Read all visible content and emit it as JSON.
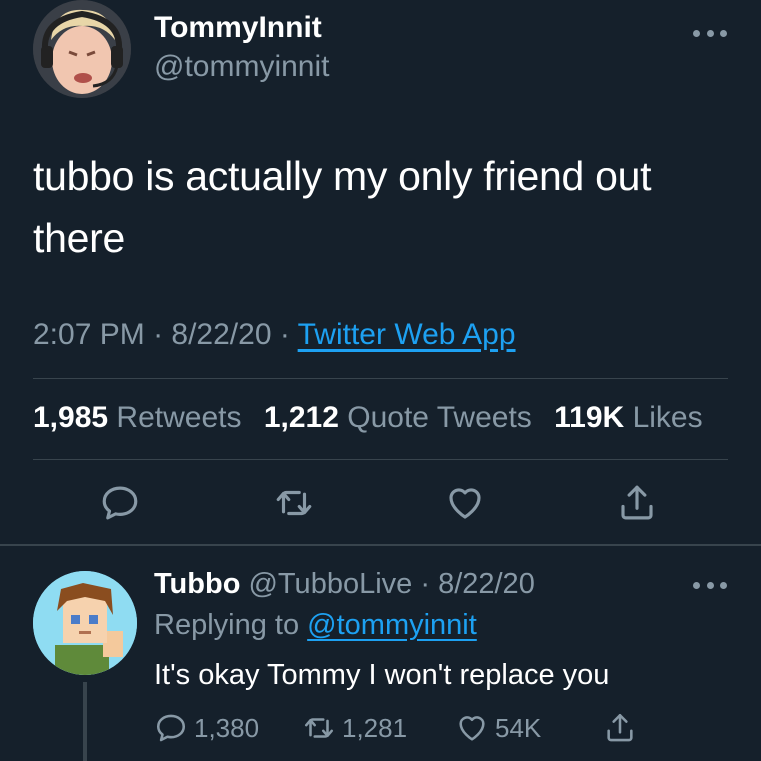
{
  "main_tweet": {
    "display_name": "TommyInnit",
    "handle": "@tommyinnit",
    "text": "tubbo is actually my only friend out there",
    "time": "2:07 PM",
    "date": "8/22/20",
    "source": "Twitter Web App",
    "stats": {
      "retweets_count": "1,985",
      "retweets_label": "Retweets",
      "quotes_count": "1,212",
      "quotes_label": "Quote Tweets",
      "likes_count": "119K",
      "likes_label": "Likes"
    },
    "actions": [
      "reply-icon",
      "retweet-icon",
      "like-icon",
      "share-icon"
    ]
  },
  "reply": {
    "display_name": "Tubbo",
    "handle": "@TubboLive",
    "date": "8/22/20",
    "replying_prefix": "Replying to",
    "replying_to": "@tommyinnit",
    "text": "It's okay Tommy I won't replace you",
    "reply_count": "1,380",
    "retweet_count": "1,281",
    "like_count": "54K"
  },
  "colors": {
    "background": "#15202b",
    "text": "#ffffff",
    "secondary": "#8899a6",
    "link": "#1da1f2",
    "divider": "#38444d"
  }
}
